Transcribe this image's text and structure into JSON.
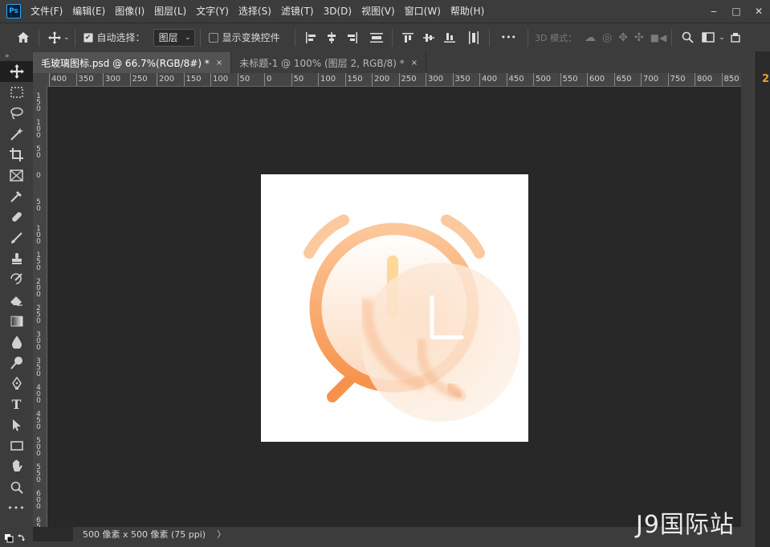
{
  "app": {
    "logo": "Ps"
  },
  "menu": [
    "文件(F)",
    "编辑(E)",
    "图像(I)",
    "图层(L)",
    "文字(Y)",
    "选择(S)",
    "滤镜(T)",
    "3D(D)",
    "视图(V)",
    "窗口(W)",
    "帮助(H)"
  ],
  "window_controls": {
    "minimize": "‒",
    "restore": "□",
    "close": "✕"
  },
  "options": {
    "auto_select_label": "自动选择：",
    "auto_select_checked": true,
    "auto_select_value": "图层",
    "show_transform_label": "显示变换控件",
    "show_transform_checked": false,
    "more_label": "•••",
    "mode_3d_label": "3D 模式："
  },
  "tabs": [
    {
      "label": "毛玻璃图标.psd @ 66.7%(RGB/8#) *",
      "active": true,
      "close": "×"
    },
    {
      "label": "未标题-1 @ 100% (图层 2, RGB/8) *",
      "active": false,
      "close": "×"
    }
  ],
  "ruler_h": [
    "400",
    "350",
    "300",
    "250",
    "200",
    "150",
    "100",
    "50",
    "0",
    "50",
    "100",
    "150",
    "200",
    "250",
    "300",
    "350",
    "400",
    "450",
    "500",
    "550",
    "600",
    "650",
    "700",
    "750",
    "800",
    "850"
  ],
  "ruler_v": [
    "1\n5\n0",
    "1\n0\n0",
    "5\n0",
    "0",
    "5\n0",
    "1\n0\n0",
    "1\n5\n0",
    "2\n0\n0",
    "2\n5\n0",
    "3\n0\n0",
    "3\n5\n0",
    "4\n0\n0",
    "4\n5\n0",
    "5\n0\n0",
    "5\n5\n0",
    "6\n0\n0",
    "6\n5\n0",
    "7\n0\n0"
  ],
  "status": {
    "doc_size": "500 像素 x 500 像素 (75 ppi)",
    "arrow": "〉"
  },
  "right_panel_badge": "2",
  "watermark": "J9国际站",
  "colors": {
    "accent": "#31a8ff",
    "clock_orange": "#f7a064",
    "glass": "#fbe3cf"
  }
}
